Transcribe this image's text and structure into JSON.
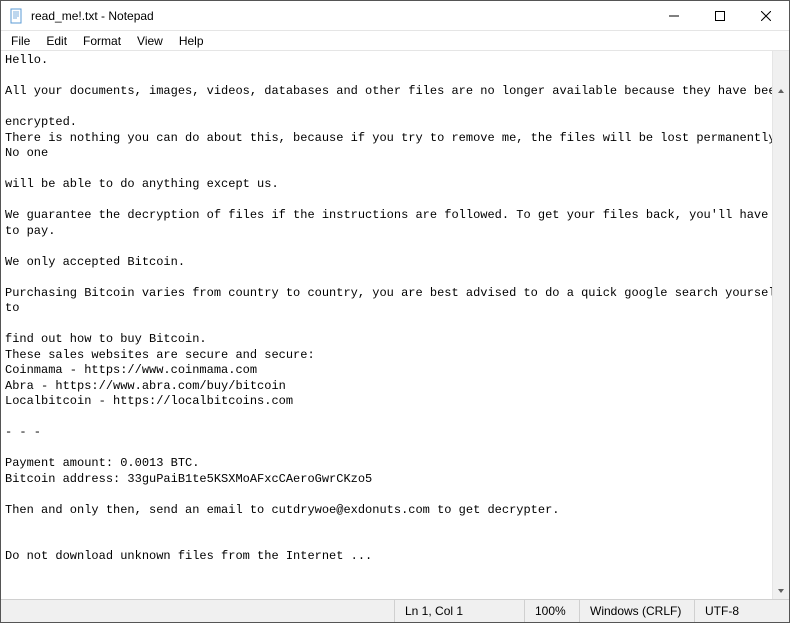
{
  "titlebar": {
    "title": "read_me!.txt - Notepad"
  },
  "menu": {
    "file": "File",
    "edit": "Edit",
    "format": "Format",
    "view": "View",
    "help": "Help"
  },
  "content": "Hello.\n\nAll your documents, images, videos, databases and other files are no longer available because they have been\n\nencrypted.\nThere is nothing you can do about this, because if you try to remove me, the files will be lost permanently. No one\n\nwill be able to do anything except us.\n\nWe guarantee the decryption of files if the instructions are followed. To get your files back, you'll have to pay.\n\nWe only accepted Bitcoin.\n\nPurchasing Bitcoin varies from country to country, you are best advised to do a quick google search yourself to\n\nfind out how to buy Bitcoin.\nThese sales websites are secure and secure:\nCoinmama - https://www.coinmama.com\nAbra - https://www.abra.com/buy/bitcoin\nLocalbitcoin - https://localbitcoins.com\n\n- - -\n\nPayment amount: 0.0013 BTC.\nBitcoin address: 33guPaiB1te5KSXMoAFxcCAeroGwrCKzo5\n\nThen and only then, send an email to cutdrywoe@exdonuts.com to get decrypter.\n\n\nDo not download unknown files from the Internet ...",
  "status": {
    "position": "Ln 1, Col 1",
    "zoom": "100%",
    "line_ending": "Windows (CRLF)",
    "encoding": "UTF-8"
  }
}
